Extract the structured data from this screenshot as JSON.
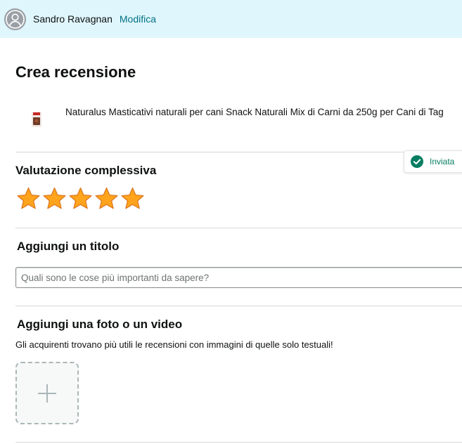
{
  "header": {
    "user_name": "Sandro Ravagnan",
    "edit_label": "Modifica"
  },
  "page": {
    "title": "Crea recensione"
  },
  "product": {
    "title": "Naturalus Masticativi naturali per cani Snack Naturali Mix di Carni da 250g per Cani di Tag"
  },
  "rating": {
    "heading": "Valutazione complessiva",
    "stars_selected": 5,
    "stars_total": 5,
    "status_label": "Inviata"
  },
  "review_title": {
    "heading": "Aggiungi un titolo",
    "placeholder": "Quali sono le cose più importanti da sapere?",
    "value": ""
  },
  "media": {
    "heading": "Aggiungi una foto o un video",
    "helper": "Gli acquirenti trovano più utili le recensioni con immagini di quelle solo testuali!"
  },
  "colors": {
    "header_bg": "#dff6fc",
    "link": "#007185",
    "star": "#ffa41c",
    "success": "#067d62"
  }
}
